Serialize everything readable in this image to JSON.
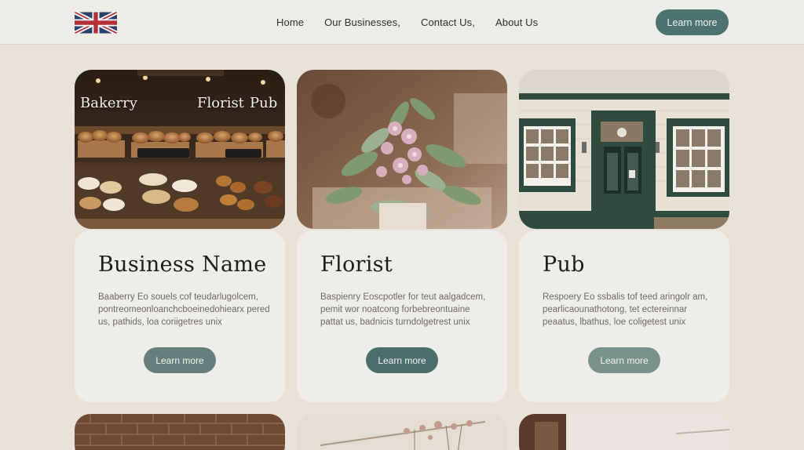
{
  "header": {
    "flag_icon": "union-jack-flag-icon",
    "nav": [
      "Home",
      "Our Businesses,",
      "Contact Us,",
      "About Us"
    ],
    "cta_label": "Learn more"
  },
  "cards": [
    {
      "image_labels": [
        "Bakerry",
        "Florist",
        "Pub"
      ],
      "image_icon": "bakery-display-photo",
      "title": "Business Name",
      "description": "Baaberry Eo souels cof teudarlugolcem, pontreomeonloanchcboeinedohiearx pered us, pathids, loa coriigetres unix",
      "button_label": "Learn more"
    },
    {
      "image_icon": "flower-bouquet-photo",
      "title": "Florist",
      "description": "Baspienry Eoscpotler for teut aalgadcem, pemit wor noatcong forbebreontuaine pattat us, badnicis turndolgetrest unix",
      "button_label": "Learn more"
    },
    {
      "image_icon": "pub-storefront-photo",
      "title": "Pub",
      "description": "Respoery Eo ssbalis tof teed aringolr am, pearlicaounathotong, tet ectereinnar peaatus, lbathus, loe coligetest unix",
      "button_label": "Learn more"
    }
  ],
  "colors": {
    "page_bg": "#e7e3da",
    "header_bg": "#eeece6",
    "card_bg": "#efede8",
    "accent": "#4d7370"
  }
}
